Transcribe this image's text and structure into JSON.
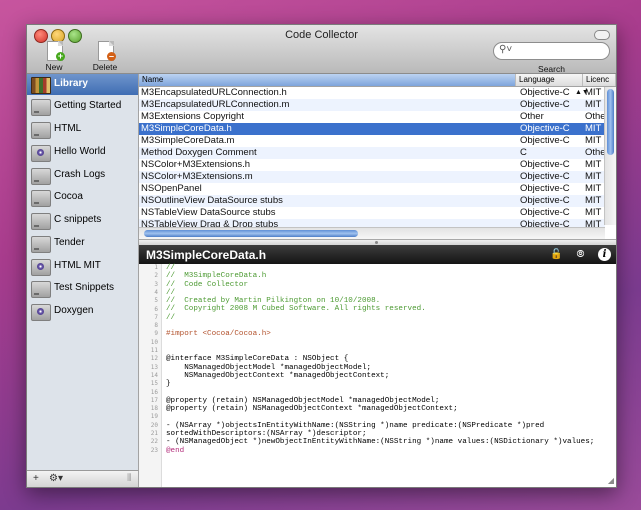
{
  "window": {
    "title": "Code Collector"
  },
  "toolbar": {
    "new_snippet": "New Snippet",
    "delete_snippet": "Delete Snippet",
    "search_placeholder": "",
    "search_label": "Search"
  },
  "sidebar": {
    "items": [
      {
        "label": "Library",
        "icon": "library-books-icon",
        "selected": true
      },
      {
        "label": "Getting Started",
        "icon": "drive-icon"
      },
      {
        "label": "HTML",
        "icon": "drive-icon"
      },
      {
        "label": "Hello World",
        "icon": "disc-icon"
      },
      {
        "label": "Crash Logs",
        "icon": "drive-icon"
      },
      {
        "label": "Cocoa",
        "icon": "drive-icon"
      },
      {
        "label": "C snippets",
        "icon": "drive-icon"
      },
      {
        "label": "Tender",
        "icon": "drive-icon"
      },
      {
        "label": "HTML MIT",
        "icon": "disc-icon"
      },
      {
        "label": "Test Snippets",
        "icon": "drive-icon"
      },
      {
        "label": "Doxygen",
        "icon": "disc-icon"
      }
    ],
    "bottom": {
      "add": "+",
      "gear": "⚙▾"
    }
  },
  "table": {
    "columns": [
      "Name",
      "Language",
      "Licenc"
    ],
    "rows": [
      {
        "name": "M3EncapsulatedURLConnection.h",
        "language": "Objective-C",
        "license": "MIT"
      },
      {
        "name": "M3EncapsulatedURLConnection.m",
        "language": "Objective-C",
        "license": "MIT"
      },
      {
        "name": "M3Extensions Copyright",
        "language": "Other",
        "license": "Other"
      },
      {
        "name": "M3SimpleCoreData.h",
        "language": "Objective-C",
        "license": "MIT",
        "selected": true
      },
      {
        "name": "M3SimpleCoreData.m",
        "language": "Objective-C",
        "license": "MIT"
      },
      {
        "name": "Method Doxygen Comment",
        "language": "C",
        "license": "Other"
      },
      {
        "name": "NSColor+M3Extensions.h",
        "language": "Objective-C",
        "license": "MIT"
      },
      {
        "name": "NSColor+M3Extensions.m",
        "language": "Objective-C",
        "license": "MIT"
      },
      {
        "name": "NSOpenPanel",
        "language": "Objective-C",
        "license": "MIT"
      },
      {
        "name": "NSOutlineView DataSource stubs",
        "language": "Objective-C",
        "license": "MIT"
      },
      {
        "name": "NSTableView DataSource stubs",
        "language": "Objective-C",
        "license": "MIT"
      },
      {
        "name": "NSTableView Drag & Drop stubs",
        "language": "Objective-C",
        "license": "MIT"
      }
    ]
  },
  "editor": {
    "title": "M3SimpleCoreData.h",
    "line_numbers": [
      "1",
      "2",
      "3",
      "4",
      "5",
      "6",
      "7",
      "8",
      "9",
      "10",
      "11",
      "12",
      "13",
      "14",
      "15",
      "16",
      "17",
      "18",
      "19",
      "20",
      "21",
      "22",
      "23"
    ],
    "lines": [
      "//",
      "//  M3SimpleCoreData.h",
      "//  Code Collector",
      "//",
      "//  Created by Martin Pilkington on 10/10/2008.",
      "//  Copyright 2008 M Cubed Software. All rights reserved.",
      "//",
      "",
      "#import <Cocoa/Cocoa.h>",
      "",
      "",
      "@interface M3SimpleCoreData : NSObject {",
      "    NSManagedObjectModel *managedObjectModel;",
      "    NSManagedObjectContext *managedObjectContext;",
      "}",
      "",
      "@property (retain) NSManagedObjectModel *managedObjectModel;",
      "@property (retain) NSManagedObjectContext *managedObjectContext;",
      "",
      "- (NSArray *)objectsInEntityWithName:(NSString *)name predicate:(NSPredicate *)pred",
      "sortedWithDescriptors:(NSArray *)descriptor;",
      "- (NSManagedObject *)newObjectInEntityWithName:(NSString *)name values:(NSDictionary *)values;",
      "@end"
    ]
  },
  "colors": {
    "selection": "#3b71cc",
    "comment": "#4c9a32",
    "keyword": "#b32e7b",
    "type": "#5a3da8",
    "string": "#c3281c"
  }
}
